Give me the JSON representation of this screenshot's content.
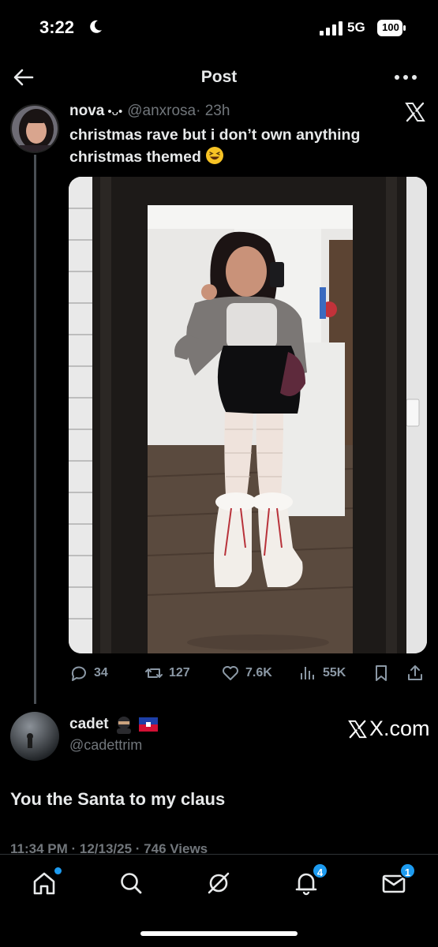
{
  "status_bar": {
    "time": "3:22",
    "network": "5G",
    "battery": "100"
  },
  "header": {
    "title": "Post"
  },
  "quoted_post": {
    "author_name": "nova",
    "author_deco": "•ᴗ•",
    "handle": "@anxrosa",
    "time_ago": "· 23h",
    "text": "christmas rave but i don’t own anything christmas themed",
    "emoji": "laughing-face-icon",
    "stats": {
      "replies": "34",
      "reposts": "127",
      "likes": "7.6K",
      "views": "55K"
    }
  },
  "reply": {
    "author_name": "cadet",
    "handle": "@cadettrim",
    "text": "You the Santa to my claus",
    "source": "X.com",
    "meta": "11:34 PM · 12/13/25 · 746 Views"
  },
  "nav": {
    "notifications_badge": "4",
    "messages_badge": "1"
  },
  "colors": {
    "background": "#000000",
    "accent": "#1d9bf0",
    "muted": "#71767b",
    "text": "#e7e9ea"
  }
}
